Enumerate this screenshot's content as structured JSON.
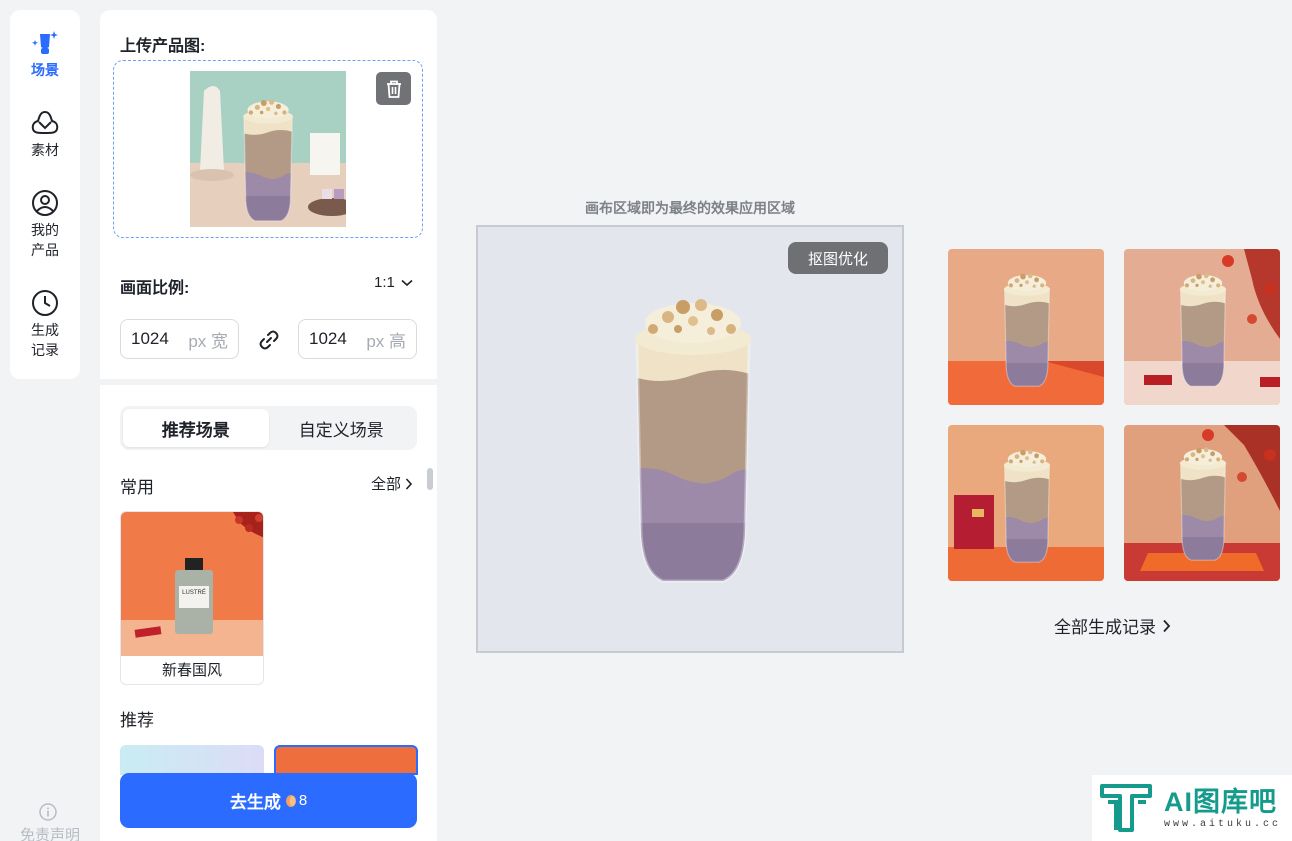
{
  "sidebar": {
    "items": [
      {
        "label": "场景",
        "active": true
      },
      {
        "label": "素材"
      },
      {
        "label": "我的产品"
      },
      {
        "label": "生成记录"
      }
    ],
    "disclaimer": "免责声明"
  },
  "upload": {
    "title": "上传产品图:"
  },
  "ratio": {
    "title": "画面比例:",
    "value": "1:1",
    "width": "1024",
    "width_unit": "px 宽",
    "height": "1024",
    "height_unit": "px 高"
  },
  "scenes": {
    "tabs": [
      {
        "label": "推荐场景",
        "active": true
      },
      {
        "label": "自定义场景"
      }
    ],
    "common_title": "常用",
    "see_all": "全部",
    "cards": [
      {
        "name": "新春国风",
        "product_label": "LUSTRÉ"
      }
    ],
    "recommend_title": "推荐"
  },
  "generate": {
    "label": "去生成",
    "credits": "8"
  },
  "canvas": {
    "hint": "画布区域即为最终的效果应用区域",
    "optimize_label": "抠图优化"
  },
  "results": {
    "history_label": "全部生成记录"
  },
  "watermark": {
    "title": "AI图库吧",
    "url": "www.aituku.cc"
  },
  "colors": {
    "accent": "#2b6bff",
    "brand_watermark": "#159b8c"
  }
}
